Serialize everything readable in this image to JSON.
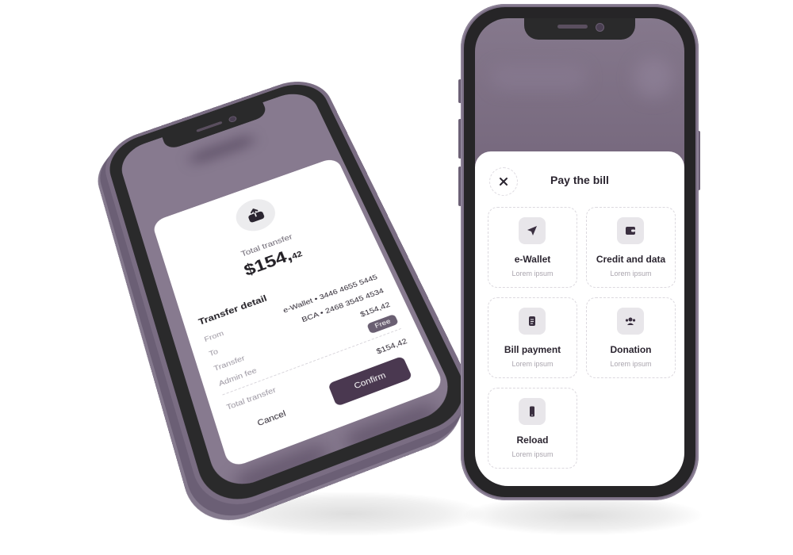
{
  "left_phone": {
    "modal": {
      "icon": "upload-transfer-icon",
      "title": "Total transfer",
      "amount_main": "$154,",
      "amount_cents": "42",
      "section_title": "Transfer detail",
      "rows": [
        {
          "label": "From",
          "value": "e-Wallet • 3446 4655 5445"
        },
        {
          "label": "To",
          "value": "BCA • 2468 3545 4534"
        },
        {
          "label": "Transfer",
          "value": "$154,42"
        },
        {
          "label": "Admin fee",
          "value": "Free"
        }
      ],
      "total_label": "Total transfer",
      "total_value": "$154,42",
      "cancel_label": "Cancel",
      "confirm_label": "Confirm"
    }
  },
  "right_phone": {
    "sheet": {
      "close_icon": "close-icon",
      "title": "Pay the bill",
      "tiles": [
        {
          "icon": "send-icon",
          "title": "e-Wallet",
          "subtitle": "Lorem ipsum"
        },
        {
          "icon": "wallet-icon",
          "title": "Credit and data",
          "subtitle": "Lorem ipsum"
        },
        {
          "icon": "document-icon",
          "title": "Bill payment",
          "subtitle": "Lorem ipsum"
        },
        {
          "icon": "people-icon",
          "title": "Donation",
          "subtitle": "Lorem ipsum"
        },
        {
          "icon": "phone-icon",
          "title": "Reload",
          "subtitle": "Lorem ipsum"
        }
      ]
    }
  },
  "colors": {
    "accent": "#4a3850",
    "phone_body": "#7a6e84",
    "badge": "#6a5f72"
  }
}
